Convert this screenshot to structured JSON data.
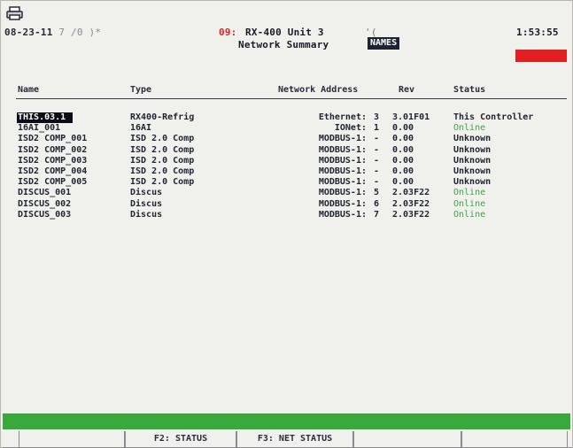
{
  "header": {
    "date": "08-23-11",
    "date_faint": " 7 /0 )*",
    "alarm_count": "09:",
    "unit": "RX-400 Unit 3",
    "temp": "'(",
    "screen_title": "Network Summary",
    "view_badge": "NAMES",
    "time": "1:53:55",
    "alarm_color": "#e41f24"
  },
  "columns": {
    "name": "Name",
    "type": "Type",
    "address": "Network Address",
    "rev": "Rev",
    "status": "Status"
  },
  "rows": [
    {
      "name": "THIS.03.1",
      "type": "RX400-Refrig",
      "address": "Ethernet:",
      "idx": "3",
      "rev": "3.01F01",
      "status": "This Controller",
      "online": false
    },
    {
      "name": "16AI_001",
      "type": "16AI",
      "address": "IONet:",
      "idx": "1",
      "rev": "0.00",
      "status": "Online",
      "online": true
    },
    {
      "name": "ISD2 COMP_001",
      "type": "ISD 2.0 Comp",
      "address": "MODBUS-1:",
      "idx": "-",
      "rev": "0.00",
      "status": "Unknown",
      "online": false
    },
    {
      "name": "ISD2 COMP_002",
      "type": "ISD 2.0 Comp",
      "address": "MODBUS-1:",
      "idx": "-",
      "rev": "0.00",
      "status": "Unknown",
      "online": false
    },
    {
      "name": "ISD2 COMP_003",
      "type": "ISD 2.0 Comp",
      "address": "MODBUS-1:",
      "idx": "-",
      "rev": "0.00",
      "status": "Unknown",
      "online": false
    },
    {
      "name": "ISD2 COMP_004",
      "type": "ISD 2.0 Comp",
      "address": "MODBUS-1:",
      "idx": "-",
      "rev": "0.00",
      "status": "Unknown",
      "online": false
    },
    {
      "name": "ISD2 COMP_005",
      "type": "ISD 2.0 Comp",
      "address": "MODBUS-1:",
      "idx": "-",
      "rev": "0.00",
      "status": "Unknown",
      "online": false
    },
    {
      "name": "DISCUS_001",
      "type": "Discus",
      "address": "MODBUS-1:",
      "idx": "5",
      "rev": "2.03F22",
      "status": "Online",
      "online": true
    },
    {
      "name": "DISCUS_002",
      "type": "Discus",
      "address": "MODBUS-1:",
      "idx": "6",
      "rev": "2.03F22",
      "status": "Online",
      "online": true
    },
    {
      "name": "DISCUS_003",
      "type": "Discus",
      "address": "MODBUS-1:",
      "idx": "7",
      "rev": "2.03F22",
      "status": "Online",
      "online": true
    }
  ],
  "colors": {
    "online": "#3fa246",
    "status_bar": "#38a93a"
  },
  "function_keys": [
    {
      "label": ""
    },
    {
      "label": "F2: STATUS"
    },
    {
      "label": "F3: NET STATUS"
    },
    {
      "label": ""
    },
    {
      "label": ""
    }
  ],
  "icons": {
    "print": "printer-icon"
  }
}
